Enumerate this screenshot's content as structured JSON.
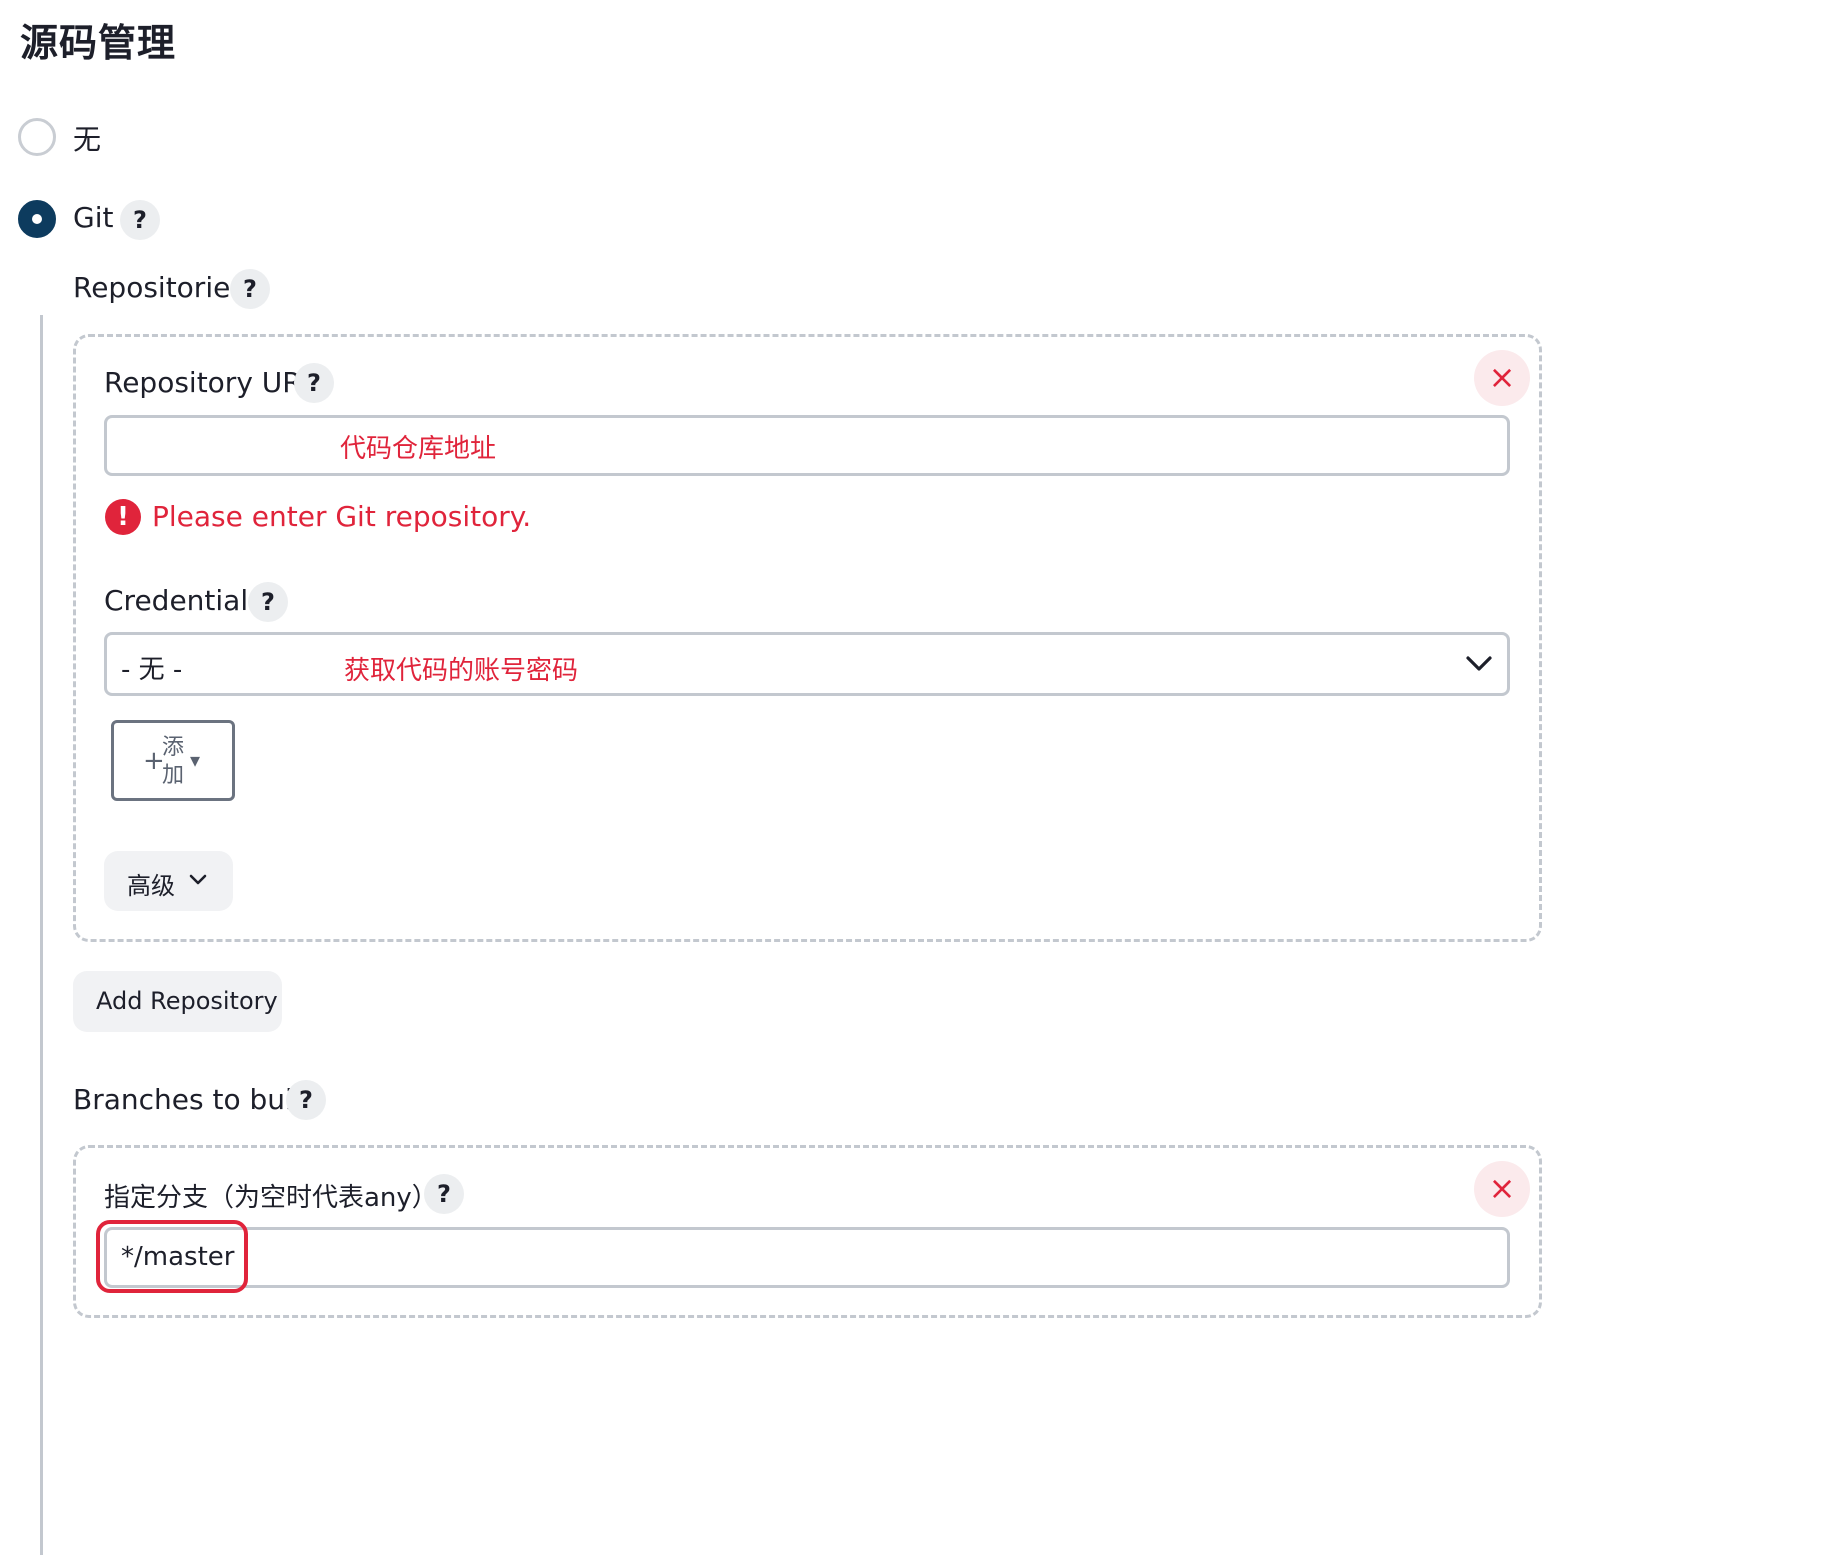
{
  "section_title": "源码管理",
  "scm_options": {
    "none_label": "无",
    "git_label": "Git"
  },
  "repositories": {
    "label": "Repositories",
    "repo_url_label": "Repository URL",
    "repo_url_annotation": "代码仓库地址",
    "error_message": "Please enter Git repository.",
    "credentials_label": "Credentials",
    "credentials_value": "- 无 -",
    "credentials_annotation": "获取代码的账号密码",
    "add_button_label_line1": "添",
    "add_button_label_line2": "加",
    "advanced_label": "高级",
    "add_repository_label": "Add Repository"
  },
  "branches": {
    "label": "Branches to build",
    "branch_specifier_label": "指定分支（为空时代表any）",
    "branch_value": "*/master"
  },
  "icons": {
    "help": "?",
    "close": "×",
    "error": "!",
    "plus": "+",
    "caret": "▾",
    "chevron": "⌄"
  },
  "colors": {
    "accent_dark": "#0d3b5e",
    "error_red": "#e0243b",
    "border_gray": "#c3c8cf"
  }
}
